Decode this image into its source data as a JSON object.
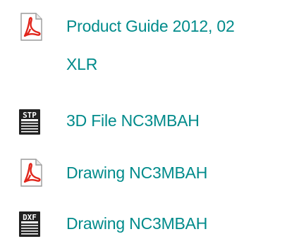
{
  "colors": {
    "link": "#008b8b",
    "pdf_red": "#e1251b",
    "icon_dark": "#222222"
  },
  "files": [
    {
      "icon": "pdf-file-icon",
      "label_lines": [
        "Product Guide 2012, 02",
        "XLR"
      ]
    },
    {
      "icon": "stp-file-icon",
      "icon_text": "STP",
      "label_lines": [
        "3D File NC3MBAH"
      ]
    },
    {
      "icon": "pdf-file-icon",
      "label_lines": [
        "Drawing NC3MBAH"
      ]
    },
    {
      "icon": "dxf-file-icon",
      "icon_text": "DXF",
      "label_lines": [
        "Drawing NC3MBAH"
      ]
    }
  ]
}
